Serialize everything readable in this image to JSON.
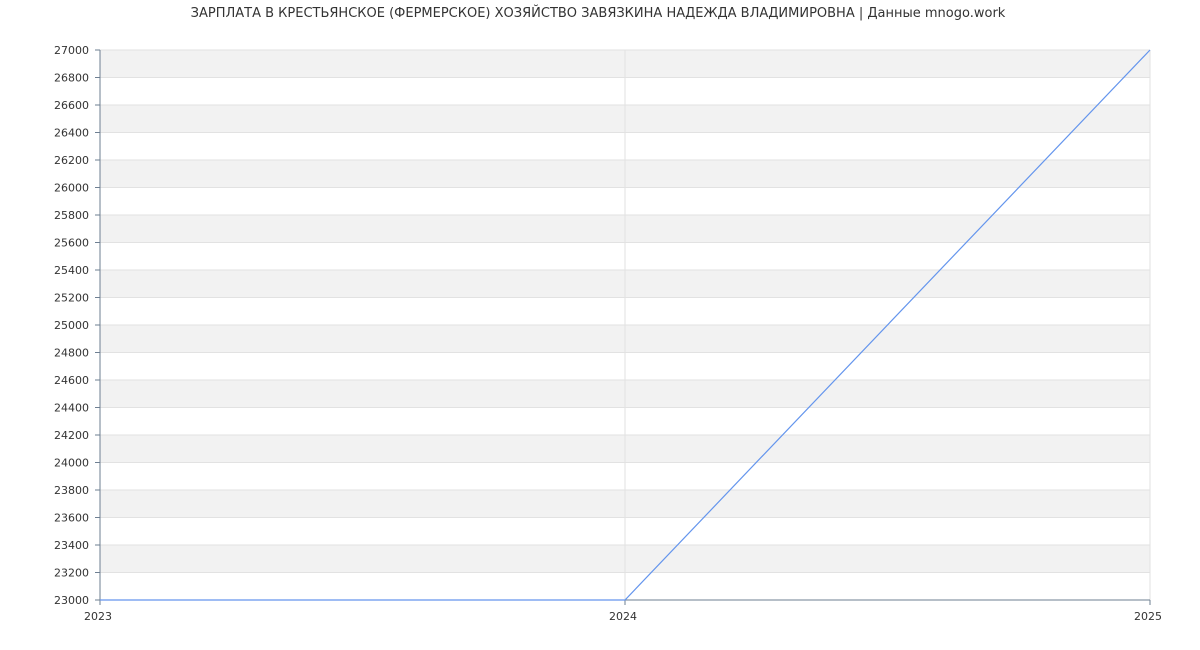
{
  "chart_data": {
    "type": "line",
    "title": "ЗАРПЛАТА В КРЕСТЬЯНСКОЕ (ФЕРМЕРСКОЕ) ХОЗЯЙСТВО ЗАВЯЗКИНА НАДЕЖДА ВЛАДИМИРОВНА | Данные mnogo.work",
    "xlabel": "",
    "ylabel": "",
    "x": [
      "2023",
      "2024",
      "2025"
    ],
    "series": [
      {
        "values": [
          23000,
          23000,
          27000
        ],
        "color": "#6495ed"
      }
    ],
    "ylim": [
      23000,
      27000
    ],
    "y_ticks": [
      23000,
      23200,
      23400,
      23600,
      23800,
      24000,
      24200,
      24400,
      24600,
      24800,
      25000,
      25200,
      25400,
      25600,
      25800,
      26000,
      26200,
      26400,
      26600,
      26800,
      27000
    ],
    "grid": true,
    "band_colors": [
      "#f2f2f2",
      "#ffffff"
    ],
    "axis_color": "#6e7f92"
  }
}
